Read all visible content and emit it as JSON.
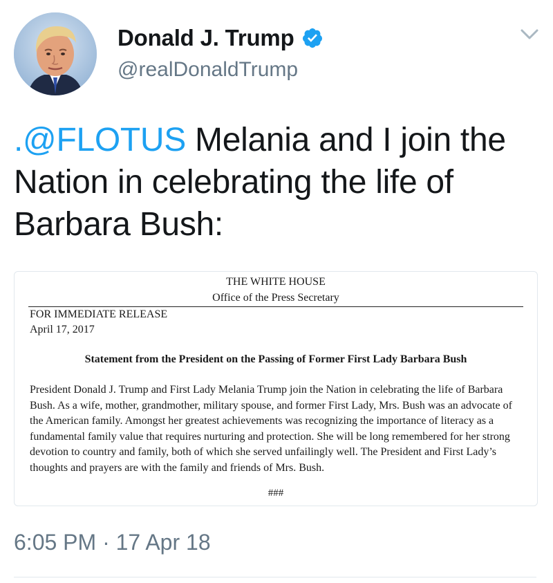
{
  "author": {
    "display_name": "Donald J. Trump",
    "handle": "@realDonaldTrump",
    "verified": true,
    "avatar_icon": "profile-photo",
    "verified_icon": "verified-badge-icon",
    "menu_icon": "chevron-down-icon"
  },
  "tweet": {
    "mention": ".@FLOTUS",
    "text": " Melania and I join the Nation in celebrating the life of Barbara Bush:",
    "timestamp": {
      "time": "6:05 PM",
      "separator": " · ",
      "date": "17 Apr 18"
    }
  },
  "attachment": {
    "header_line1": "THE WHITE HOUSE",
    "header_line2": "Office of the Press Secretary",
    "release_label": "FOR IMMEDIATE RELEASE",
    "release_date": "April 17, 2017",
    "statement_title": "Statement from the President on the Passing of Former First Lady Barbara Bush",
    "body": "President Donald J. Trump and First Lady Melania Trump join the Nation in celebrating the life of Barbara Bush. As a wife, mother, grandmother, military spouse, and former First Lady, Mrs. Bush was an advocate of the American family. Amongst her greatest achievements was recognizing the importance of literacy as a fundamental family value that requires nurturing and protection. She will be long remembered for her strong devotion to country and family, both of which she served unfailingly well. The President and First Lady’s thoughts and prayers are with the family and friends of Mrs. Bush.",
    "end_mark": "###"
  },
  "colors": {
    "link": "#1da1f2",
    "text": "#14171a",
    "secondary": "#657786",
    "border": "#e1e8ed"
  }
}
